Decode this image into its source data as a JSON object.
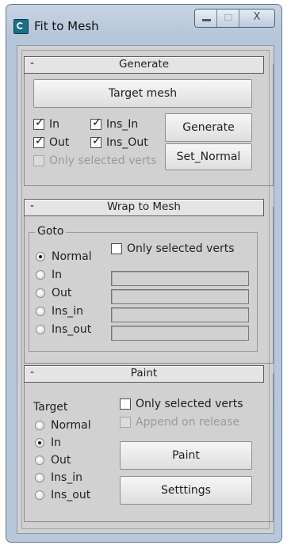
{
  "window": {
    "title": "Fit to Mesh",
    "minimize_icon": "minimize-icon",
    "maximize_icon": "maximize-icon",
    "close_glyph": "X",
    "app_icon": "app-icon"
  },
  "generate": {
    "header": "Generate",
    "collapse": "-",
    "target_mesh_label": "Target mesh",
    "checks": [
      {
        "label": "In",
        "checked": true
      },
      {
        "label": "Ins_In",
        "checked": true
      },
      {
        "label": "Out",
        "checked": true
      },
      {
        "label": "Ins_Out",
        "checked": true
      }
    ],
    "only_selected_label": "Only selected verts",
    "generate_label": "Generate",
    "set_normal_label": "Set_Normal"
  },
  "wrap": {
    "header": "Wrap to Mesh",
    "collapse": "-",
    "goto_label": "Goto",
    "only_selected_label": "Only selected verts",
    "radios": [
      {
        "label": "Normal",
        "selected": true
      },
      {
        "label": "In",
        "selected": false
      },
      {
        "label": "Out",
        "selected": false
      },
      {
        "label": "Ins_in",
        "selected": false
      },
      {
        "label": "Ins_out",
        "selected": false
      }
    ]
  },
  "paint": {
    "header": "Paint",
    "collapse": "-",
    "target_label": "Target",
    "radios": [
      {
        "label": "Normal",
        "selected": false
      },
      {
        "label": "In",
        "selected": true
      },
      {
        "label": "Out",
        "selected": false
      },
      {
        "label": "Ins_in",
        "selected": false
      },
      {
        "label": "Ins_out",
        "selected": false
      }
    ],
    "only_selected_label": "Only selected verts",
    "append_label": "Append on release",
    "paint_label": "Paint",
    "settings_label": "Setttings"
  }
}
